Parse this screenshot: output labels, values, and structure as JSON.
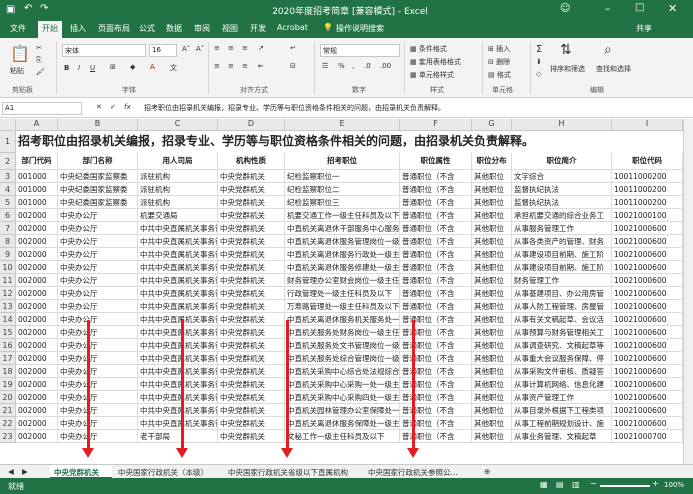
{
  "window": {
    "title": "2020年度招考简章 [兼容模式] - Excel",
    "share": "共享"
  },
  "qat": {
    "autosave": "自动保存",
    "off": "关"
  },
  "tabs": [
    "文件",
    "开始",
    "插入",
    "页面布局",
    "公式",
    "数据",
    "审阅",
    "视图",
    "开发",
    "Acrobat",
    "操作说明搜索"
  ],
  "ribbon": {
    "paste": "粘贴",
    "clipboard": "剪贴板",
    "font_name": "宋体",
    "font_size": "16",
    "font_group": "字体",
    "align_group": "对齐方式",
    "number_format": "常规",
    "number_group": "数字",
    "cond_fmt": "条件格式",
    "table_fmt": "套用表格格式",
    "cell_style": "单元格样式",
    "styles_group": "样式",
    "insert": "插入",
    "delete": "删除",
    "format": "格式",
    "cells_group": "单元格",
    "sort": "排序和筛选",
    "find": "查找和选择",
    "edit_group": "编辑"
  },
  "formula": {
    "namebox": "A1",
    "fx": "fx",
    "content": "招考职位由招录机关编报，招录专业、学历等与职位资格条件相关的问题，由招录机关负责解释。"
  },
  "columns": [
    "A",
    "B",
    "C",
    "D",
    "E",
    "F",
    "G",
    "H",
    "I"
  ],
  "banner": "招考职位由招录机关编报，招录专业、学历等与职位资格条件相关的问题，由招录机关负责解释。",
  "headers": [
    "部门代码",
    "部门名称",
    "用人司局",
    "机构性质",
    "招考职位",
    "职位属性",
    "职位分布",
    "职位简介",
    "职位代码"
  ],
  "rows": [
    [
      "3",
      "001000",
      "中央纪委国家监察委",
      "派驻机构",
      "中央党群机关",
      "纪检监察职位一",
      "普通职位（不含",
      "其他职位",
      "文字综合",
      "10011000200"
    ],
    [
      "4",
      "001000",
      "中央纪委国家监察委",
      "派驻机构",
      "中央党群机关",
      "纪检监察职位二",
      "普通职位（不含",
      "其他职位",
      "监督执纪执法",
      "10011000200"
    ],
    [
      "5",
      "001000",
      "中央纪委国家监察委",
      "派驻机构",
      "中央党群机关",
      "纪检监察职位三",
      "普通职位（不含",
      "其他职位",
      "监督执纪执法",
      "10011000200"
    ],
    [
      "6",
      "002000",
      "中央办公厅",
      "机要交通局",
      "中央党群机关",
      "机要交通工作一级主任科员及以下",
      "普通职位（不含",
      "其他职位",
      "承担机要交通的综合业务工",
      "10021000100"
    ],
    [
      "7",
      "002000",
      "中央办公厅",
      "中共中央直属机关事务管",
      "中央党群机关",
      "中直机关离退休干部服务中心服务处",
      "普通职位（不含",
      "其他职位",
      "从事服务管理工作",
      "10021000600"
    ],
    [
      "8",
      "002000",
      "中央办公厅",
      "中共中央直属机关事务管",
      "中央党群机关",
      "中直机关离退休服务管理岗位一级主",
      "普通职位（不含",
      "其他职位",
      "从事各类资产的管理、财务",
      "10021000600"
    ],
    [
      "9",
      "002000",
      "中央办公厅",
      "中共中央直属机关事务管",
      "中央党群机关",
      "中直机关离退休服务行政处一级主任",
      "普通职位（不含",
      "其他职位",
      "从事建设项目前期、施工阶",
      "10021000600"
    ],
    [
      "10",
      "002000",
      "中央办公厅",
      "中共中央直属机关事务管",
      "中央党群机关",
      "中直机关离退休服务修建处一级主任",
      "普通职位（不含",
      "其他职位",
      "从事建设项目前期、施工阶",
      "10021000600"
    ],
    [
      "11",
      "002000",
      "中央办公厅",
      "中共中央直属机关事务管",
      "中央党群机关",
      "财务管理办公室财会岗位一级主任科",
      "普通职位（不含",
      "其他职位",
      "财务管理工作",
      "10021000600"
    ],
    [
      "12",
      "002000",
      "中央办公厅",
      "中共中央直属机关事务管",
      "中央党群机关",
      "行政管理处一级主任科员及以下",
      "普通职位（不含",
      "其他职位",
      "从事基建项目、办公用房管",
      "10021000600"
    ],
    [
      "13",
      "002000",
      "中央办公厅",
      "中共中央直属机关事务管",
      "中央党群机关",
      "万寿路管理处一级主任科员及以下",
      "普通职位（不含",
      "其他职位",
      "从事人防工程管理、房屋管",
      "10021000600"
    ],
    [
      "14",
      "002000",
      "中央办公厅",
      "中共中央直属机关事务管",
      "中央党群机关",
      "中直机关离退休服务机关服务处一级主任",
      "普通职位（不含",
      "其他职位",
      "从事有关文稿起草、会议活",
      "10021000600"
    ],
    [
      "15",
      "002000",
      "中央办公厅",
      "中共中央直属机关事务管",
      "中央党群机关",
      "中直机关服务处财务岗位一级主任科",
      "普通职位（不含",
      "其他职位",
      "从事预算与财务管理相关工",
      "10021000600"
    ],
    [
      "16",
      "002000",
      "中央办公厅",
      "中共中央直属机关事务管",
      "中央党群机关",
      "中直机关服务处文书管理岗位一级主",
      "普通职位（不含",
      "其他职位",
      "从事调查研究、文稿起草等",
      "10021000600"
    ],
    [
      "17",
      "002000",
      "中央办公厅",
      "中共中央直属机关事务管",
      "中央党群机关",
      "中直机关服务处综合管理岗位一级主",
      "普通职位（不含",
      "其他职位",
      "从事重大会议服务保障、停",
      "10021000600"
    ],
    [
      "18",
      "002000",
      "中央办公厅",
      "中共中央直属机关事务管",
      "中央党群机关",
      "中直机关采购中心综合处法规综合岗",
      "普通职位（不含",
      "其他职位",
      "从事采购文件审核、质疑答",
      "10021000600"
    ],
    [
      "19",
      "002000",
      "中央办公厅",
      "中共中央直属机关事务管",
      "中央党群机关",
      "中直机关采购中心采购一处一级主任",
      "普通职位（不含",
      "其他职位",
      "从事计算机网络、信息化建",
      "10021000600"
    ],
    [
      "20",
      "002000",
      "中央办公厅",
      "中共中央直属机关事务管",
      "中央党群机关",
      "中直机关采购中心采购四处一级主任",
      "普通职位（不含",
      "其他职位",
      "从事资产管理工作",
      "10021000600"
    ],
    [
      "21",
      "002000",
      "中央办公厅",
      "中共中央直属机关事务管",
      "中央党群机关",
      "中直机关园林管理办公室保障处一级",
      "普通职位（不含",
      "其他职位",
      "从事目录外根据下工程类项",
      "10021000600"
    ],
    [
      "22",
      "002000",
      "中央办公厅",
      "中共中央直属机关事务管",
      "中央党群机关",
      "中直机关离退休服务保障处一级主任",
      "普通职位（不含",
      "其他职位",
      "从事工程前期规划设计、施",
      "10021000600"
    ],
    [
      "23",
      "002000",
      "中央办公厅",
      "老干部局",
      "中央党群机关",
      "文秘工作一级主任科员及以下",
      "普通职位（不含",
      "其他职位",
      "从事业务管理、文稿起草",
      "10021000700"
    ]
  ],
  "sheets": [
    "中央党群机关",
    "中央国家行政机关（本级）",
    "中央国家行政机关省级以下直属机构",
    "中央国家行政机关参照公..."
  ],
  "status": {
    "ready": "就绪",
    "zoom": "100%"
  }
}
